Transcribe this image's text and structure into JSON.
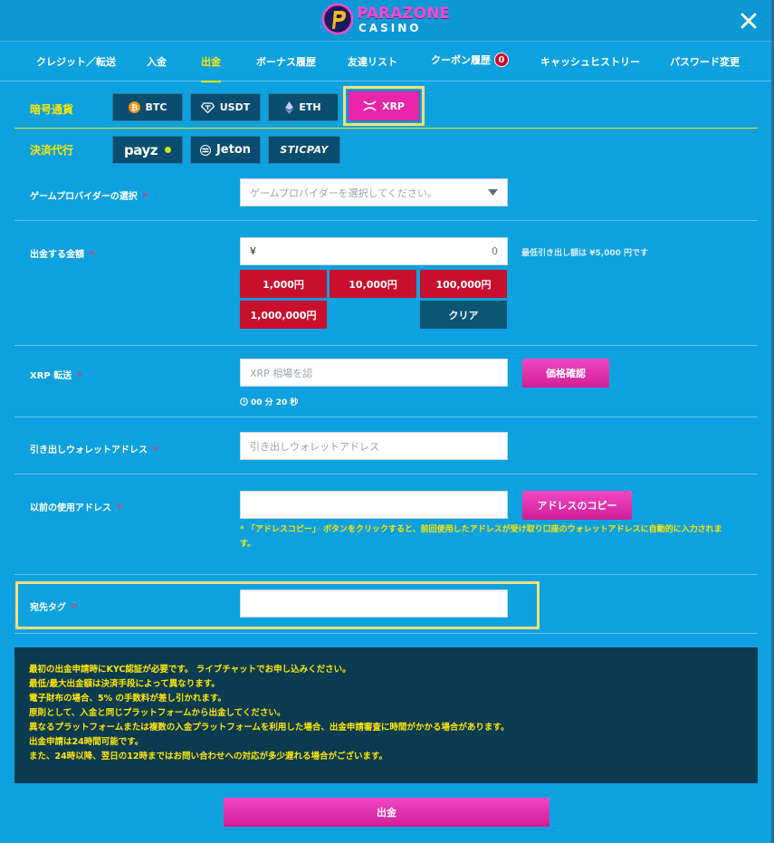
{
  "brand": {
    "name_top": "PARAZONE",
    "name_bottom": "CASINO"
  },
  "tabs": [
    {
      "label": "クレジット／転送"
    },
    {
      "label": "入金"
    },
    {
      "label": "出金"
    },
    {
      "label": "ボーナス履歴"
    },
    {
      "label": "友達リスト"
    },
    {
      "label": "クーポン履歴",
      "badge": "0"
    },
    {
      "label": "キャッシュヒストリー"
    },
    {
      "label": "パスワード変更"
    }
  ],
  "crypto": {
    "label": "暗号通貨",
    "options": [
      {
        "label": "BTC",
        "icon": "bitcoin-icon"
      },
      {
        "label": "USDT",
        "icon": "tether-icon"
      },
      {
        "label": "ETH",
        "icon": "ethereum-icon"
      },
      {
        "label": "XRP",
        "icon": "xrp-icon"
      }
    ]
  },
  "payment_agent": {
    "label": "決済代行",
    "options": [
      {
        "label": "payz"
      },
      {
        "label": "Jeton"
      },
      {
        "label": "STICPAY"
      }
    ]
  },
  "form": {
    "provider": {
      "label": "ゲームプロバイダーの選択",
      "required": "*",
      "placeholder": "ゲームプロバイダーを選択してください。"
    },
    "amount": {
      "label": "出金する金額",
      "required": "*",
      "currency": "¥",
      "value": "0",
      "min_note": "最低引き出し額は ¥5,000 円です",
      "presets": [
        "1,000円",
        "10,000円",
        "100,000円",
        "1,000,000円"
      ],
      "clear": "クリア"
    },
    "xrp": {
      "label": "XRP 転送",
      "required": "*",
      "placeholder": "XRP 相場を認",
      "check_button": "価格確認",
      "timer": "00 分 20 秒"
    },
    "wallet": {
      "label": "引き出しウォレットアドレス",
      "required": "*",
      "placeholder": "引き出しウォレットアドレス"
    },
    "prev_address": {
      "label": "以前の使用アドレス",
      "required": "*",
      "copy_button": "アドレスのコピー",
      "note_line1": "* 「アドレスコピー」 ボタンをクリックすると、前回使用したアドレスが受け取り口座のウォレットアドレスに自動的に入力されま",
      "note_line2": "す。"
    },
    "dest_tag": {
      "label": "宛先タグ",
      "required": "*"
    }
  },
  "info": [
    "最初の出金申請時にKYC認証が必要です。 ライブチャットでお申し込みください。",
    "最低/最大出金額は決済手段によって異なります。",
    "電子財布の場合、5% の手数料が差し引かれます。",
    "原則として、入金と同じプラットフォームから出金してください。",
    "異なるプラットフォームまたは複数の入金プラットフォームを利用した場合、出金申請審査に時間がかかる場合があります。",
    "出金申請は24時間可能です。",
    "また、24時以降、翌日の12時まではお問い合わせへの対応が多少遅れる場合がございます。"
  ],
  "submit": "出金"
}
